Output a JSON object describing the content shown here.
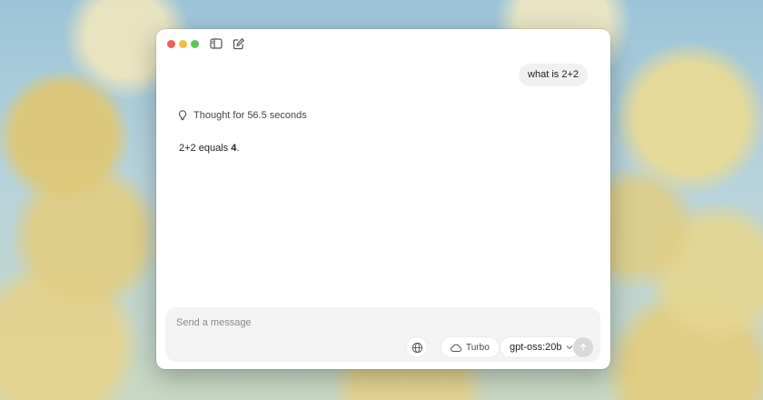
{
  "chat": {
    "user_message": "what is 2+2",
    "thought_label": "Thought for 56.5 seconds",
    "answer_prefix": "2+2 equals ",
    "answer_bold": "4",
    "answer_suffix": "."
  },
  "composer": {
    "placeholder": "Send a message",
    "turbo_label": "Turbo",
    "model_label": "gpt-oss:20b"
  },
  "icons": {
    "sidebar_toggle": "sidebar-icon",
    "new_chat": "compose-icon",
    "thought": "lightbulb-icon",
    "web_search": "globe-icon",
    "turbo": "cloud-icon",
    "model_menu": "chevron-down-icon",
    "send": "arrow-up-icon"
  },
  "colors": {
    "close": "#ee5f57",
    "minimize": "#f5bd3a",
    "maximize": "#5fc454",
    "send_disabled": "#d9d9d9"
  }
}
